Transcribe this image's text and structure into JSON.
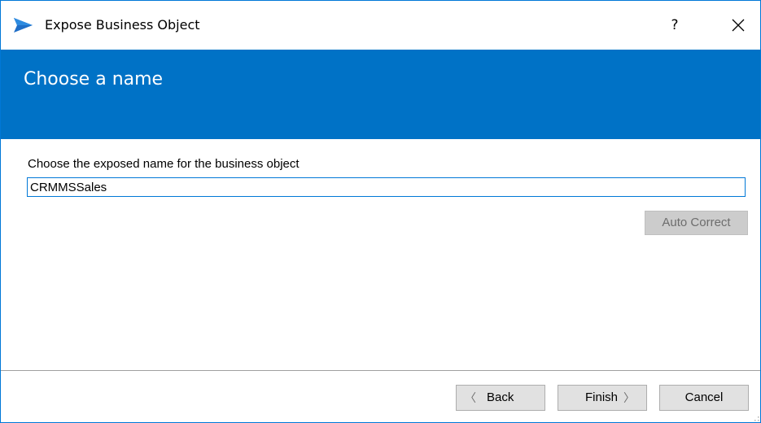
{
  "window": {
    "title": "Expose Business Object",
    "help_label": "?",
    "close_icon": "close-icon",
    "app_icon": "blue-arrow-logo-icon",
    "accent_color": "#0072c6"
  },
  "header": {
    "title": "Choose a name"
  },
  "form": {
    "label": "Choose the exposed name for the business object",
    "name_value": "CRMMSSales",
    "auto_correct_label": "Auto Correct",
    "auto_correct_enabled": false
  },
  "footer": {
    "back_label": "Back",
    "back_arrow": "〈",
    "finish_label": "Finish",
    "finish_arrow": "〉",
    "cancel_label": "Cancel"
  }
}
